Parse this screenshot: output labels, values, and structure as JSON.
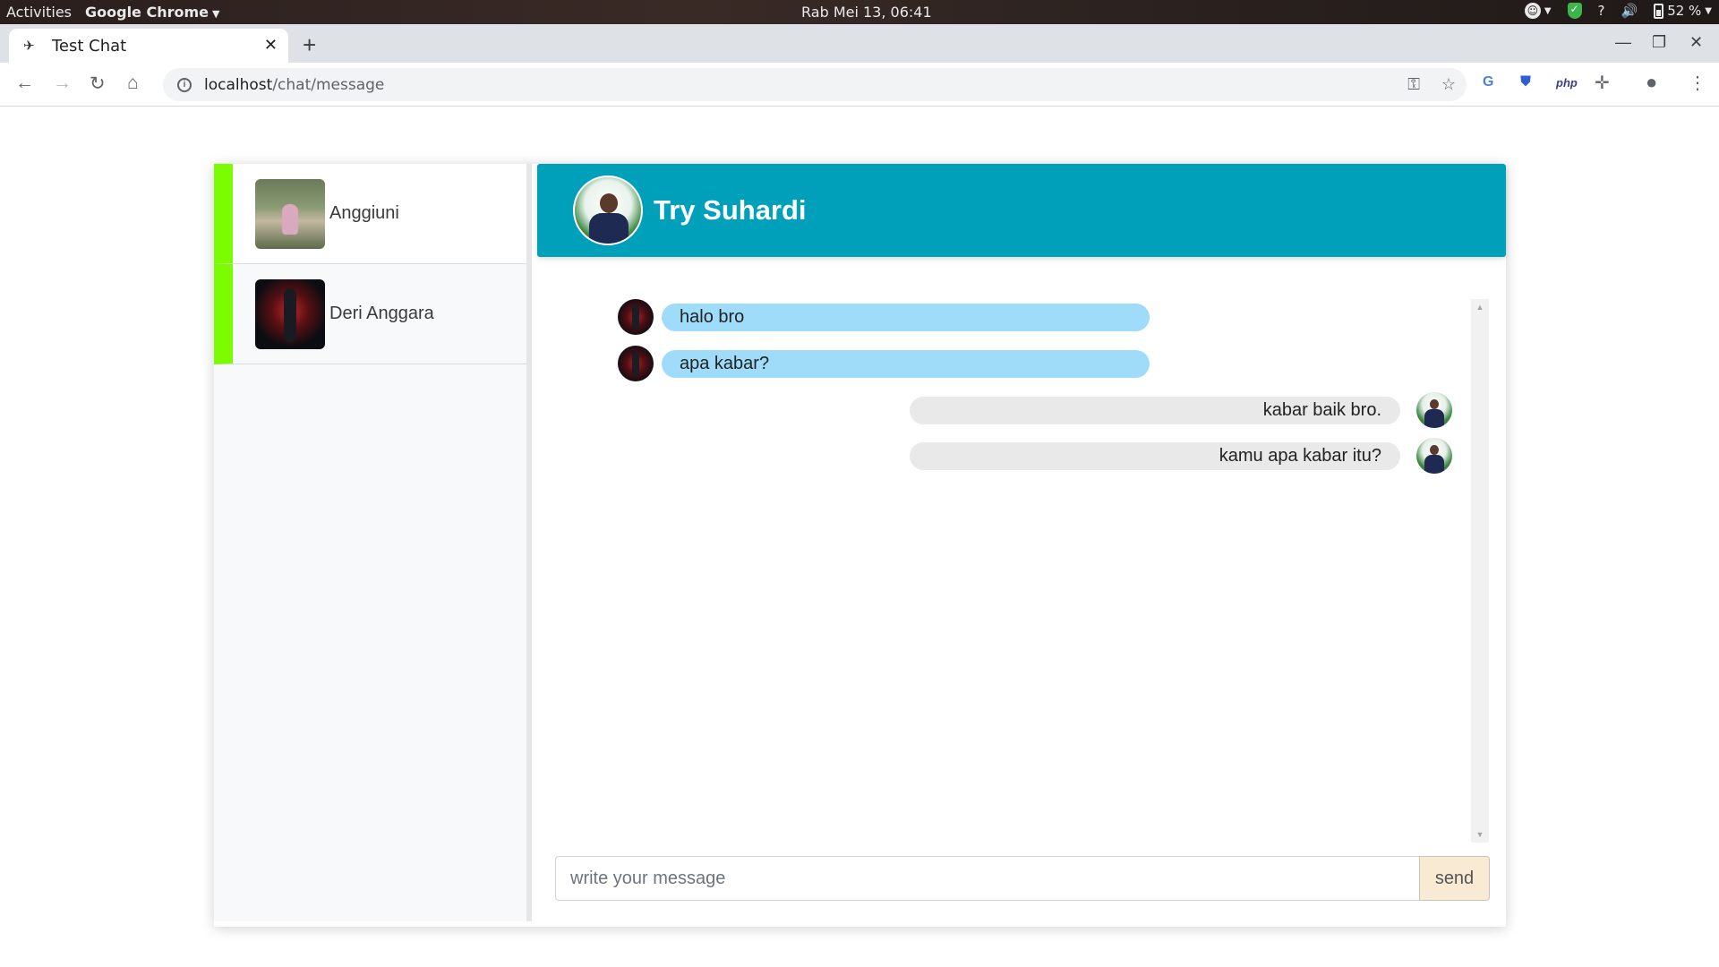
{
  "os_bar": {
    "activities": "Activities",
    "app_name": "Google Chrome",
    "clock": "Rab Mei 13, 06:41",
    "battery": "52 %"
  },
  "browser": {
    "tab_title": "Test Chat",
    "url_host": "localhost",
    "url_path": "/chat/message",
    "extension_php": "php"
  },
  "sidebar": {
    "contacts": [
      {
        "name": "Anggiuni"
      },
      {
        "name": "Deri Anggara"
      }
    ]
  },
  "chat": {
    "header_name": "Try Suhardi",
    "messages": [
      {
        "direction": "in",
        "text": "halo bro"
      },
      {
        "direction": "in",
        "text": "apa kabar?"
      },
      {
        "direction": "out",
        "text": "kabar baik bro."
      },
      {
        "direction": "out",
        "text": "kamu apa kabar itu?"
      }
    ],
    "input_placeholder": "write your message",
    "send_label": "send"
  },
  "colors": {
    "header_bg": "#00a0bb",
    "contact_accent": "#7cfc00",
    "incoming_bubble": "#9fdcfa",
    "outgoing_bubble": "#e9e9e9",
    "send_button_bg": "#f9ead3"
  }
}
